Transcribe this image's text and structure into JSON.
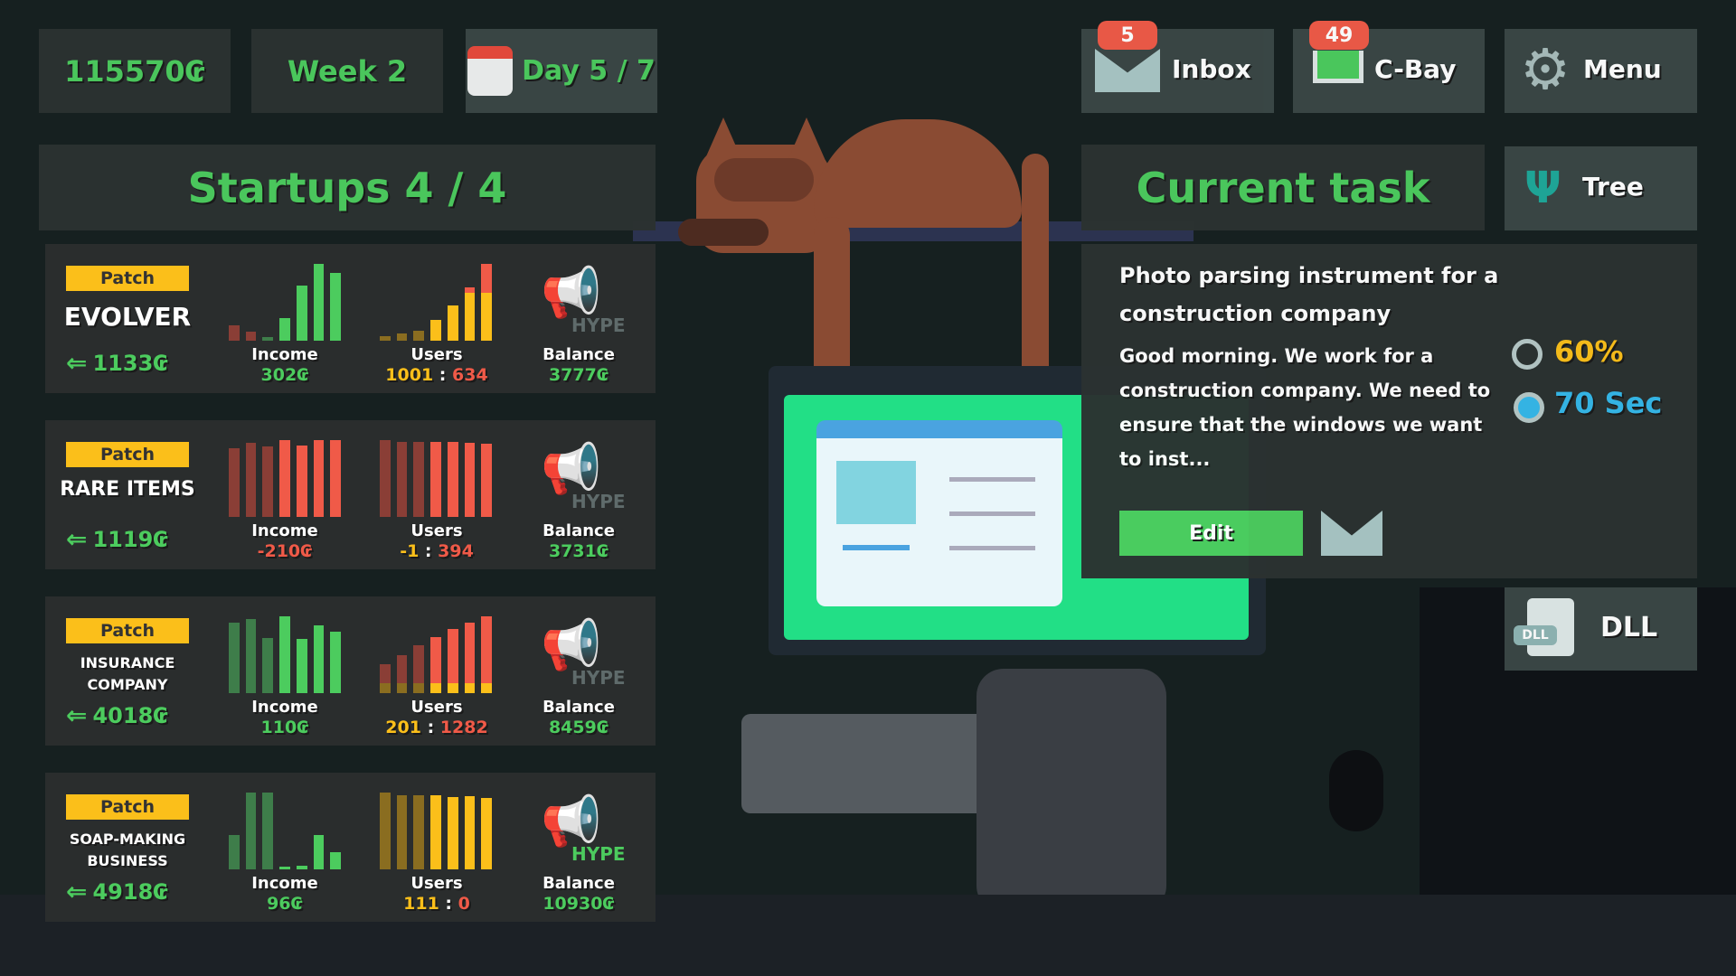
{
  "topbar": {
    "money": "115570₢",
    "week": "Week 2",
    "day": "Day 5 / 7",
    "inbox": {
      "label": "Inbox",
      "badge": "5"
    },
    "cbay": {
      "label": "C-Bay",
      "badge": "49"
    },
    "menu": {
      "label": "Menu"
    }
  },
  "startups": {
    "title": "Startups 4 / 4",
    "patch_label": "Patch",
    "income_label": "Income",
    "users_label": "Users",
    "balance_label": "Balance",
    "hype_label": "HYPE",
    "items": [
      {
        "name": "EVOLVER",
        "refund": "1133₢",
        "income": "302₢",
        "income_color": "#4ccc5e",
        "users_a": "1001",
        "users_b": "634",
        "balance": "3777₢",
        "hype_active": false,
        "income_bars": [
          [
            0.2,
            "#8a3e36"
          ],
          [
            0.12,
            "#8a3e36"
          ],
          [
            0.05,
            "#3e7d4a"
          ],
          [
            0.3,
            "#4ccc5e"
          ],
          [
            0.72,
            "#4ccc5e"
          ],
          [
            1,
            "#4ccc5e"
          ],
          [
            0.88,
            "#4ccc5e"
          ]
        ],
        "user_bars": [
          [
            0.06,
            0,
            true
          ],
          [
            0.09,
            0,
            true
          ],
          [
            0.13,
            0,
            true
          ],
          [
            0.27,
            0,
            false
          ],
          [
            0.46,
            0,
            false
          ],
          [
            0.62,
            0.08,
            false
          ],
          [
            0.62,
            0.38,
            false
          ]
        ]
      },
      {
        "name": "RARE ITEMS",
        "refund": "1119₢",
        "income": "-210₢",
        "income_color": "#f05a48",
        "users_a": "-1",
        "users_b": "394",
        "balance": "3731₢",
        "hype_active": false,
        "income_bars": [
          [
            0.9,
            "#8a3e36"
          ],
          [
            0.96,
            "#8a3e36"
          ],
          [
            0.92,
            "#8a3e36"
          ],
          [
            1,
            "#f05a48"
          ],
          [
            0.93,
            "#f05a48"
          ],
          [
            1,
            "#f05a48"
          ],
          [
            1,
            "#f05a48"
          ]
        ],
        "user_bars": [
          [
            0,
            1,
            true
          ],
          [
            0,
            0.98,
            true
          ],
          [
            0,
            0.98,
            true
          ],
          [
            0,
            0.98,
            false
          ],
          [
            0,
            0.98,
            false
          ],
          [
            0,
            0.97,
            false
          ],
          [
            0,
            0.95,
            false
          ]
        ]
      },
      {
        "name": "INSURANCE COMPANY",
        "refund": "4018₢",
        "income": "110₢",
        "income_color": "#4ccc5e",
        "users_a": "201",
        "users_b": "1282",
        "balance": "8459₢",
        "hype_active": false,
        "income_bars": [
          [
            0.92,
            "#3e7d4a"
          ],
          [
            0.96,
            "#3e7d4a"
          ],
          [
            0.72,
            "#3e7d4a"
          ],
          [
            1,
            "#4ccc5e"
          ],
          [
            0.71,
            "#4ccc5e"
          ],
          [
            0.88,
            "#4ccc5e"
          ],
          [
            0.8,
            "#4ccc5e"
          ]
        ],
        "user_bars": [
          [
            0.13,
            0.25,
            true
          ],
          [
            0.13,
            0.37,
            true
          ],
          [
            0.13,
            0.49,
            true
          ],
          [
            0.13,
            0.6,
            false
          ],
          [
            0.13,
            0.7,
            false
          ],
          [
            0.13,
            0.79,
            false
          ],
          [
            0.13,
            0.87,
            false
          ]
        ]
      },
      {
        "name": "SOAP-MAKING BUSINESS",
        "refund": "4918₢",
        "income": "96₢",
        "income_color": "#4ccc5e",
        "users_a": "111",
        "users_b": "0",
        "balance": "10930₢",
        "hype_active": true,
        "income_bars": [
          [
            0.45,
            "#3e7d4a"
          ],
          [
            1,
            "#3e7d4a"
          ],
          [
            1,
            "#3e7d4a"
          ],
          [
            0.03,
            "#4ccc5e"
          ],
          [
            0.05,
            "#4ccc5e"
          ],
          [
            0.45,
            "#4ccc5e"
          ],
          [
            0.22,
            "#4ccc5e"
          ]
        ],
        "user_bars": [
          [
            1,
            0,
            true
          ],
          [
            0.97,
            0,
            true
          ],
          [
            0.97,
            0,
            true
          ],
          [
            0.97,
            0,
            false
          ],
          [
            0.94,
            0,
            false
          ],
          [
            0.95,
            0,
            false
          ],
          [
            0.93,
            0,
            false
          ]
        ]
      }
    ]
  },
  "task": {
    "header": "Current task",
    "title": "Photo parsing instrument for a construction company",
    "description": "Good morning. We work for a construction company. We need to ensure that the windows we want to inst...",
    "accuracy": "60%",
    "time": "70 Sec",
    "edit_label": "Edit"
  },
  "tree": {
    "label": "Tree"
  },
  "dll": {
    "label": "DLL",
    "icon_text": "DLL"
  },
  "colors": {
    "green": "#4ccc5e",
    "yellow": "#fbbf1a",
    "red": "#f05a48",
    "blue": "#35b8ea",
    "panel": "#2b3231"
  }
}
